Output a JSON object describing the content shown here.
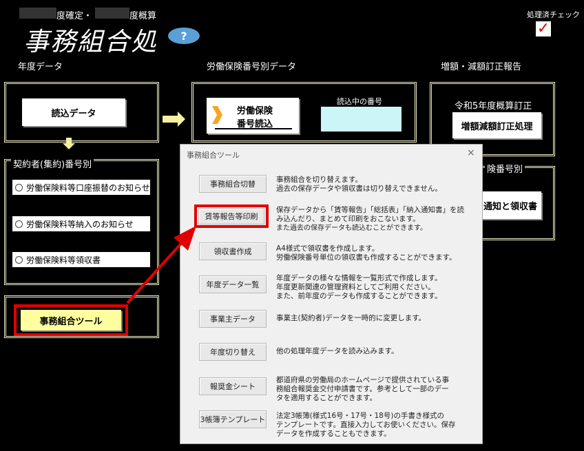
{
  "top": {
    "fiscal_label": "度確定・",
    "fiscal_label2": "度概算",
    "app_title": "事務組合処",
    "help_icon": "?",
    "processed_check_label": "処理済チェック",
    "processed_check_mark": "✓"
  },
  "sections": {
    "year_data": "年度データ",
    "insurance_data": "労働保険番号別データ",
    "adjust_report": "増額・減額訂正報告",
    "contractor": "契約者(集約)番号別",
    "insurance_no_right": "険番号別"
  },
  "buttons": {
    "read_data": "読込データ",
    "insurance_read_line1": "労働保険",
    "insurance_read_line2": "番号読込",
    "current_number_label": "読込中の番号",
    "current_number_value": "",
    "reiwa_label": "令和5年度概算訂正",
    "adjust_process": "増額減額訂正処理",
    "notice_receipt": "通知と領収書",
    "union_tool": "事務組合ツール"
  },
  "options": [
    "労働保険料等口座振替のお知らせ",
    "労働保険料等納入のお知らせ",
    "労働保険料等領収書"
  ],
  "dialog": {
    "title": "事務組合ツール",
    "close": "×",
    "items": [
      {
        "label": "事務組合切替",
        "desc": [
          "事務組合を切り替えます。",
          "過去の保存データや領収書は切り替えできません。"
        ]
      },
      {
        "label": "賃等報告等印刷",
        "desc": [
          "保存データから「賃等報告」「総括表」「納入通知書」を読",
          "み込んだり、まとめて印刷をおこないます。",
          "また過去の保存データも読込むことができます。"
        ]
      },
      {
        "label": "領収書作成",
        "desc": [
          "A4様式で領収書を作成します。",
          "労働保険番号単位の領収書も作成することができます。"
        ]
      },
      {
        "label": "年度データ一覧",
        "desc": [
          "年度データの様々な情報を一覧形式で作成します。",
          "年度更新関連の管理資料としてご利用ください。",
          "また、前年度のデータも作成することができます。"
        ]
      },
      {
        "label": "事業主データ",
        "desc": [
          "事業主(契約者)データを一時的に変更します。"
        ]
      },
      {
        "label": "年度切り替え",
        "desc": [
          "他の処理年度データを読み込みます。"
        ]
      },
      {
        "label": "報奨金シート",
        "desc": [
          "都道府県の労働局のホームページで提供されている事",
          "務組合報奨金交付申請書です。参考として一部のデー",
          "タを適用することができます。"
        ]
      },
      {
        "label": "3帳簿テンプレート",
        "desc": [
          "法定3帳簿(様式16号・17号・18号)の手書き様式の",
          "テンプレートです。直接入力してお使いください。保存",
          "データを作成することもできます。"
        ]
      }
    ]
  },
  "colors": {
    "background": "#000000",
    "frame": "#f2f0c8",
    "highlight": "#e00000",
    "tool_button": "#ffffa0",
    "arrow": "#f5f0a0",
    "help": "#5a9fd6"
  }
}
